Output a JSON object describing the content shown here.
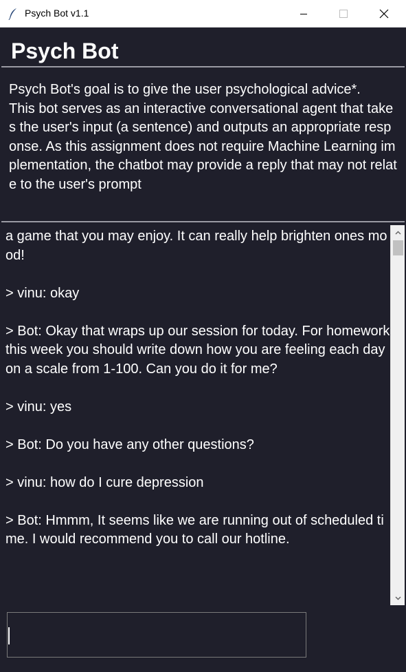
{
  "window": {
    "title": "Psych Bot v1.1",
    "icon": "feather-icon"
  },
  "header": {
    "title": "Psych Bot"
  },
  "description": {
    "text": "Psych Bot's goal is to give the user psychological advice*.\nThis bot serves as an interactive conversational agent that takes the user's input (a sentence) and outputs an appropriate response. As this assignment does not require Machine Learning implementation, the chatbot may provide a reply that may not relate to the user's prompt"
  },
  "chat": {
    "text": "a game that you may enjoy. It can really help brighten ones mood!\n\n> vinu: okay\n\n> Bot: Okay that wraps up our session for today. For homework this week you should write down how you are feeling each day on a scale from 1-100. Can you do it for me?\n\n> vinu: yes\n\n> Bot: Do you have any other questions?\n\n> vinu: how do I cure depression\n\n> Bot: Hmmm, It seems like we are running out of scheduled time. I would recommend you to call our hotline."
  },
  "input": {
    "value": ""
  },
  "colors": {
    "background": "#1f1f2b",
    "text": "#ffffff",
    "divider": "#9a9aa3"
  }
}
